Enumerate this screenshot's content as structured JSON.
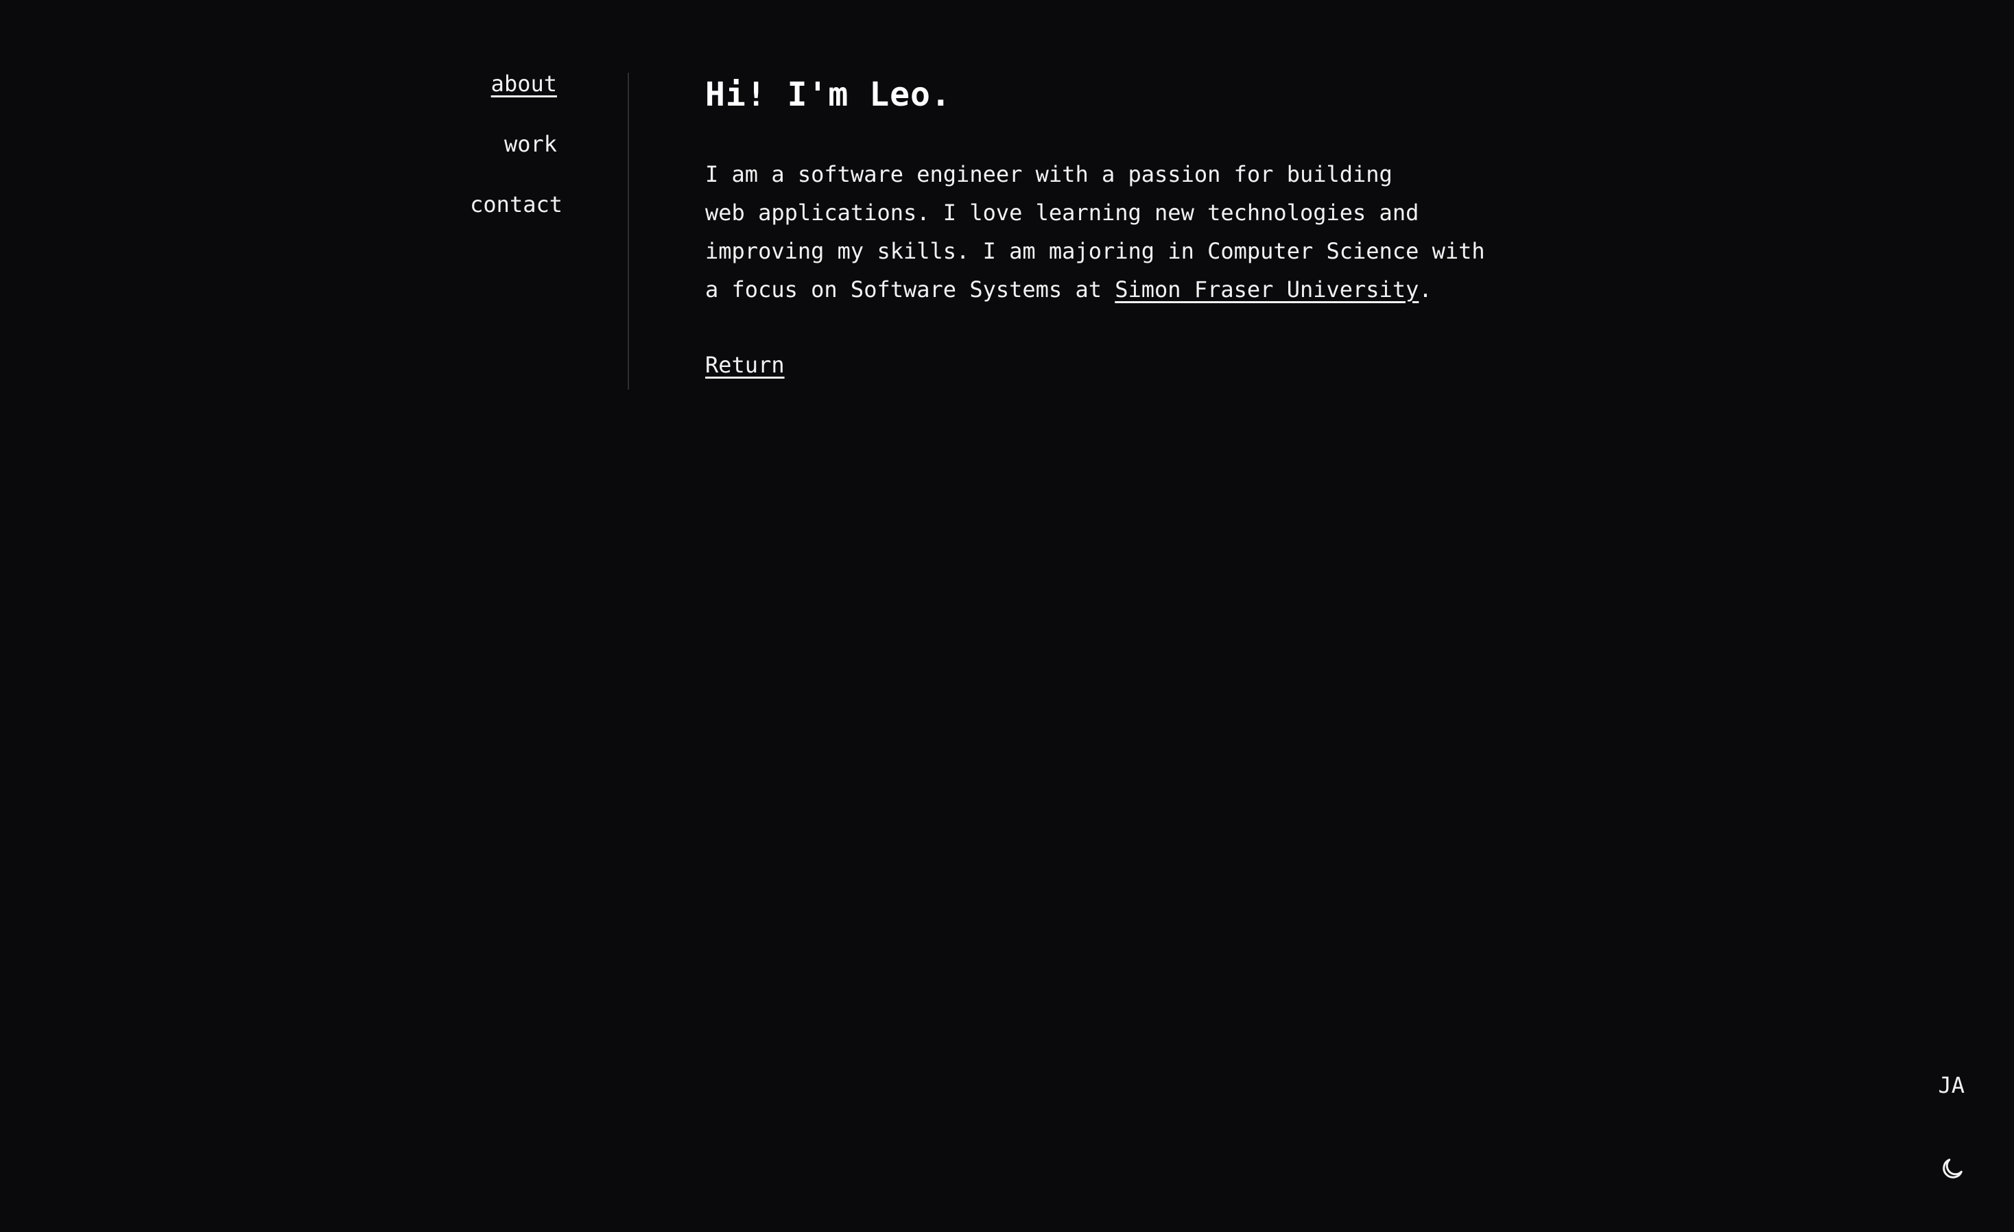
{
  "nav": {
    "items": [
      {
        "label": "about"
      },
      {
        "label": "work"
      },
      {
        "label": "contact"
      }
    ]
  },
  "main": {
    "title": "Hi! I'm Leo.",
    "bio_lines": [
      "I am a software engineer with a passion for building",
      "web applications. I love learning new technologies and",
      "improving my skills. I am majoring in Computer Science with",
      "a focus on Software Systems at "
    ],
    "university_link": "Simon Fraser University",
    "bio_end": ".",
    "return_label": "Return"
  },
  "controls": {
    "language_label": "JA",
    "theme_icon": "moon-icon"
  }
}
